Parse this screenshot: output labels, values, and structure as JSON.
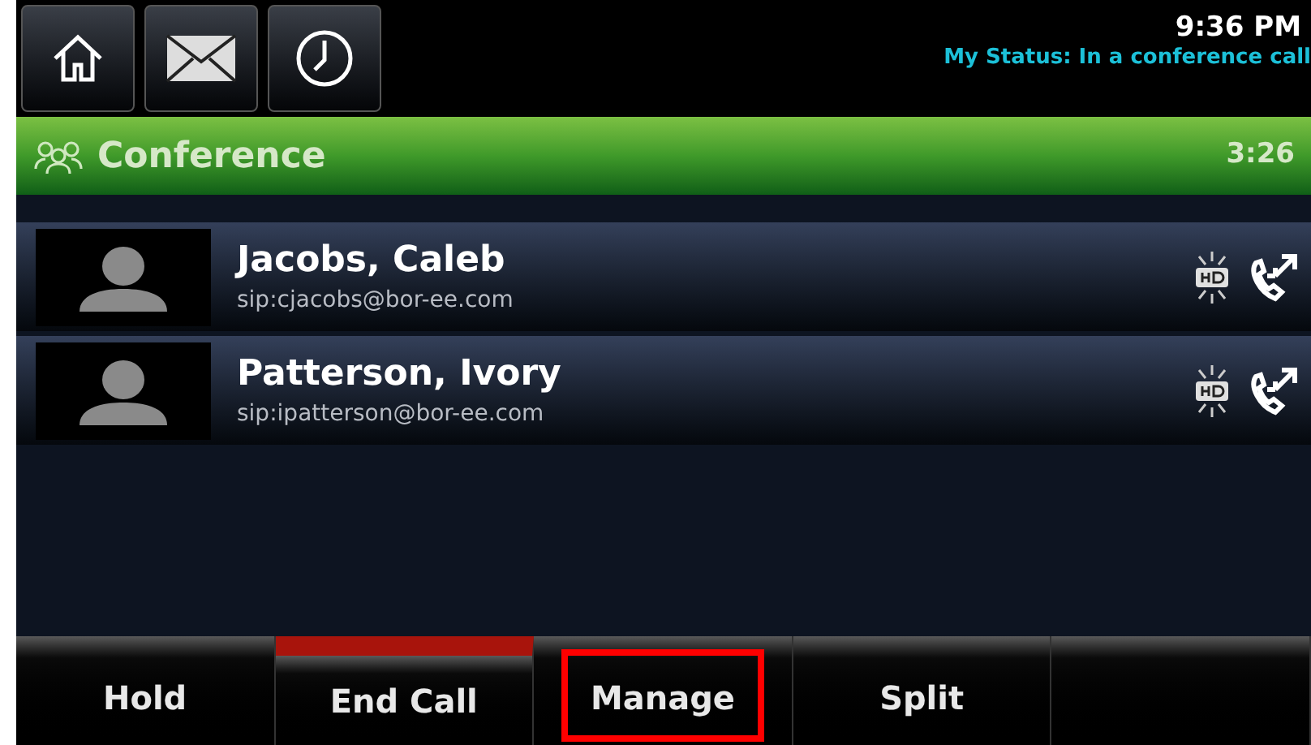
{
  "top_bar": {
    "buttons": [
      {
        "kind": "home"
      },
      {
        "kind": "messages"
      },
      {
        "kind": "recents"
      }
    ],
    "time": "9:36 PM",
    "status": "My Status: In a conference call"
  },
  "header": {
    "title": "Conference",
    "duration": "3:26"
  },
  "calls": [
    {
      "name": "Jacobs, Caleb",
      "address": "sip:cjacobs@bor-ee.com",
      "hd": true
    },
    {
      "name": "Patterson, Ivory",
      "address": "sip:ipatterson@bor-ee.com",
      "hd": true
    }
  ],
  "softkeys": [
    {
      "label": "Hold",
      "danger": false,
      "highlighted": false
    },
    {
      "label": "End Call",
      "danger": true,
      "highlighted": false
    },
    {
      "label": "Manage",
      "danger": false,
      "highlighted": true
    },
    {
      "label": "Split",
      "danger": false,
      "highlighted": false
    },
    {
      "danger": false,
      "highlighted": false
    }
  ]
}
